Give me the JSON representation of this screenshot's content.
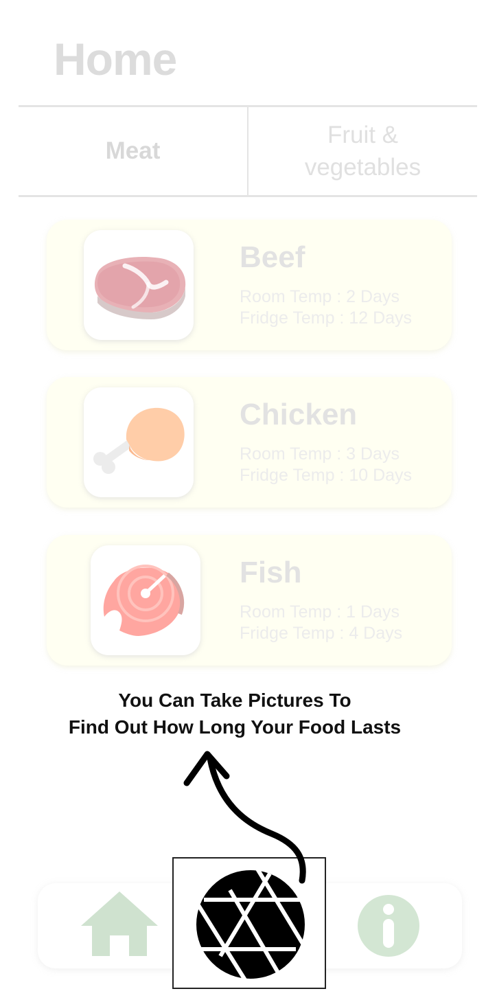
{
  "header": {
    "title": "Home"
  },
  "tabs": [
    {
      "label": "Meat",
      "selected": true
    },
    {
      "label": "Fruit &\nvegetables",
      "selected": false
    }
  ],
  "foods": [
    {
      "name": "Beef",
      "room": "Room Temp : 2 Days",
      "fridge": "Fridge Temp : 12 Days",
      "icon": "steak-icon"
    },
    {
      "name": "Chicken",
      "room": "Room Temp : 3 Days",
      "fridge": "Fridge Temp : 10 Days",
      "icon": "chicken-leg-icon"
    },
    {
      "name": "Fish",
      "room": "Room Temp : 1 Days",
      "fridge": "Fridge Temp : 4 Days",
      "icon": "salmon-steak-icon"
    }
  ],
  "tip": {
    "line1": "You Can Take Pictures To",
    "line2": "Find Out How Long Your Food Lasts"
  },
  "bottom_nav": [
    {
      "icon": "home-icon"
    },
    {
      "icon": "camera-shutter-icon"
    },
    {
      "icon": "info-icon"
    }
  ],
  "colors": {
    "card_bg": "#fffff2",
    "faded_icon": "#d5e6d5",
    "tip_text": "#111111"
  }
}
